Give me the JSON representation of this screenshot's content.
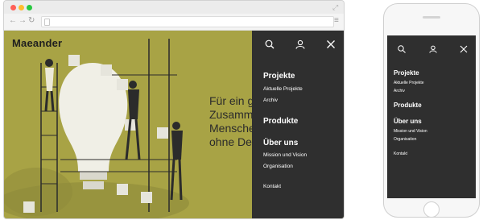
{
  "site": {
    "logo_text": "Maeander",
    "hero_lines": [
      "Für ein g",
      "Zusamm",
      "Mensche",
      "ohne De"
    ]
  },
  "menu": {
    "icons": [
      "search-icon",
      "user-icon",
      "close-icon"
    ],
    "sections": [
      {
        "label": "Projekte",
        "items": [
          "Aktuelle Projekte",
          "Archiv"
        ]
      },
      {
        "label": "Produkte",
        "items": []
      },
      {
        "label": "Über uns",
        "items": [
          "Mission und Vision",
          "Organisation"
        ]
      }
    ],
    "contact": "Kontakt"
  },
  "browser": {
    "traffic_lights": [
      "#ff5f57",
      "#ffbd2e",
      "#28c840"
    ]
  },
  "colors": {
    "olive": "#a8a345",
    "panel": "#2f2f2f"
  }
}
